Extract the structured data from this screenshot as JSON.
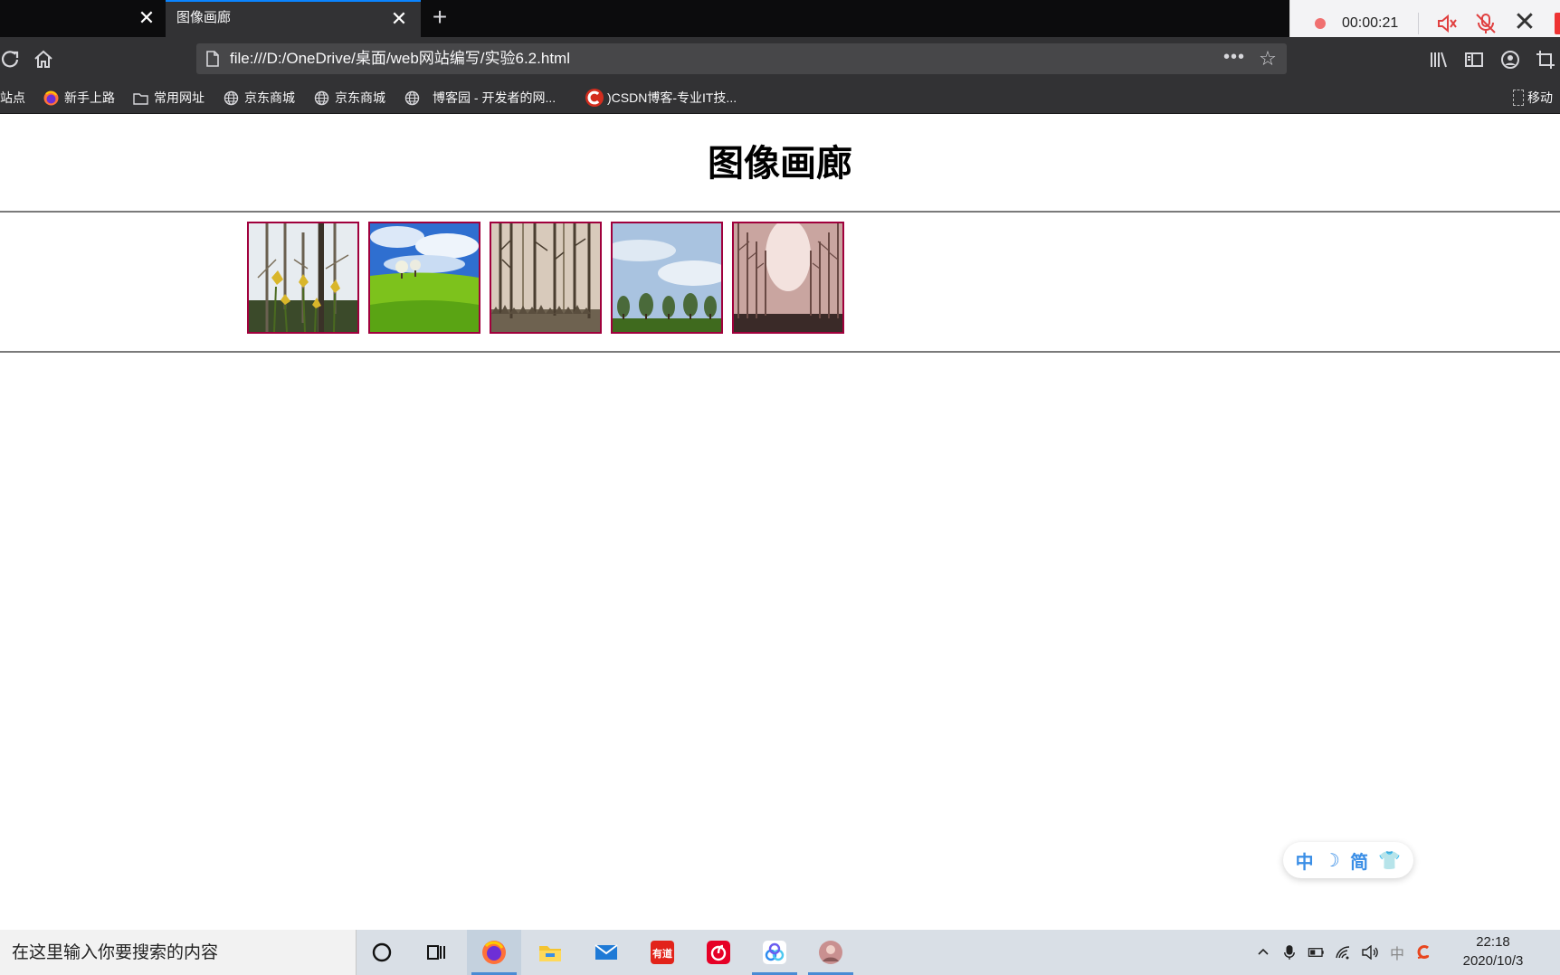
{
  "browser": {
    "tabs": [
      {
        "title": "",
        "active": false
      },
      {
        "title": "图像画廊",
        "active": true
      }
    ],
    "new_tab_label": "+",
    "url": "file:///D:/OneDrive/桌面/web网站编写/实验6.2.html",
    "more_label": "•••",
    "bookmarks": [
      {
        "label": "访问最多的站点",
        "visible": "站点"
      },
      {
        "label": "新手上路",
        "icon": "firefox-icon"
      },
      {
        "label": "常用网址",
        "icon": "folder-icon"
      },
      {
        "label": "京东商城",
        "icon": "globe-icon"
      },
      {
        "label": "京东商城",
        "icon": "globe-icon"
      },
      {
        "label": "博客园 - 开发者的网...",
        "icon": "globe-icon"
      },
      {
        "label": ")CSDN博客-专业IT技...",
        "icon": "csdn-icon"
      }
    ],
    "mobile_bookmarks_label": "移动"
  },
  "recorder": {
    "elapsed": "00:00:21"
  },
  "page": {
    "heading": "图像画廊",
    "gallery": [
      {
        "name": "daffodils-birch-trees",
        "palette": [
          "#e7ecf0",
          "#4a4437",
          "#c9a62a"
        ]
      },
      {
        "name": "green-hill-blue-sky",
        "palette": [
          "#2f6fd0",
          "#7dc21c",
          "#3a8a10"
        ]
      },
      {
        "name": "misty-forest",
        "palette": [
          "#d8cabb",
          "#5a4a38",
          "#a9987f"
        ]
      },
      {
        "name": "row-of-trees-sky",
        "palette": [
          "#a9c3e0",
          "#3e5a2a",
          "#2f5a1a"
        ]
      },
      {
        "name": "pink-foggy-alley",
        "palette": [
          "#e9d2cf",
          "#7a5a55",
          "#3a2a28"
        ]
      }
    ]
  },
  "ime_widget": {
    "items": [
      "中",
      "☽",
      "简",
      "👕"
    ]
  },
  "taskbar": {
    "search_placeholder": "在这里输入你要搜索的内容",
    "time": "22:18",
    "date": "2020/10/3",
    "ime_indicator": "中"
  }
}
